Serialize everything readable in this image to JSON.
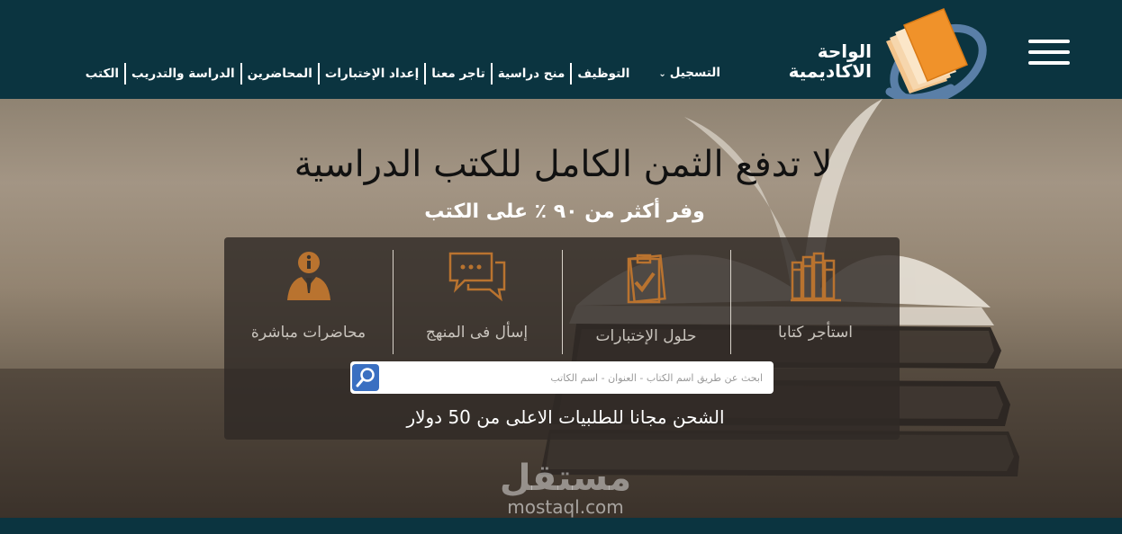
{
  "header": {
    "logo": {
      "line1": "الواحة",
      "line2": "الاكاديمية"
    },
    "menu_icon": "hamburger-menu-icon",
    "nav": [
      {
        "label": "الكتب"
      },
      {
        "label": "الدراسة والتدريب"
      },
      {
        "label": "المحاضرين"
      },
      {
        "label": "إعداد الإختبارات"
      },
      {
        "label": "تاجر معنا"
      },
      {
        "label": "منح دراسية"
      },
      {
        "label": "التوظيف"
      },
      {
        "label": "التسجيل"
      }
    ],
    "register_chevron": "chevron-down-icon"
  },
  "hero": {
    "title": "لا تدفع الثمن الكامل للكتب الدراسية",
    "subtitle": "وفر أكثر من ٩٠ ٪ على الكتب",
    "services": [
      {
        "label": "استأجر كتابا",
        "icon": "books-shelf-icon"
      },
      {
        "label": "حلول الإختبارات",
        "icon": "clipboard-check-icon"
      },
      {
        "label": "إسأل فى المنهج",
        "icon": "chat-bubbles-icon"
      },
      {
        "label": "محاضرات مباشرة",
        "icon": "lecturer-info-icon"
      }
    ],
    "search": {
      "placeholder": "ابحث عن طريق اسم الكتاب - العنوان - اسم الكاتب",
      "value": "",
      "button_icon": "search-icon"
    },
    "shipping_note": "الشحن مجانا للطلبيات الاعلى من 50 دولار"
  },
  "watermark": {
    "arabic": "مستقل",
    "latin": "mostaql.com"
  },
  "colors": {
    "header_bg": "#0b3440",
    "accent_orange": "#f0922a",
    "icon_brown": "#b9732f",
    "search_button": "#3a6fc1",
    "logo_ring": "#5a7fa7"
  }
}
